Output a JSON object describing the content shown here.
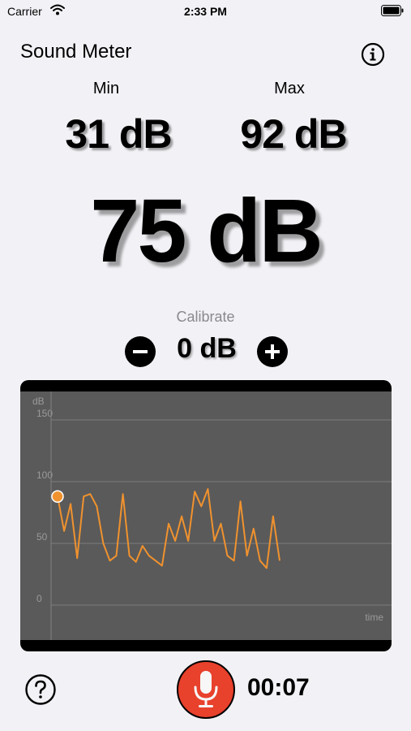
{
  "status": {
    "carrier": "Carrier",
    "time": "2:33 PM"
  },
  "app": {
    "title": "Sound Meter"
  },
  "stats": {
    "min_label": "Min",
    "min_value": "31 dB",
    "max_label": "Max",
    "max_value": "92 dB",
    "current_value": "75 dB"
  },
  "calibrate": {
    "label": "Calibrate",
    "value": "0 dB"
  },
  "recording": {
    "elapsed": "00:07",
    "accent_color": "#e8412c"
  },
  "chart_data": {
    "type": "line",
    "ylabel": "dB",
    "xlabel": "time",
    "ylim": [
      0,
      150
    ],
    "yticks": [
      0,
      50,
      100,
      150
    ],
    "grid": true,
    "line_color": "#f0922e",
    "background": "#5a5a5a",
    "series": [
      {
        "values": [
          88,
          60,
          82,
          38,
          88,
          90,
          80,
          50,
          36,
          40,
          90,
          40,
          35,
          48,
          40,
          36,
          32,
          66,
          52,
          72,
          52,
          92,
          80,
          94,
          52,
          66,
          40,
          36,
          84,
          40,
          62,
          36,
          30,
          72,
          36
        ]
      }
    ]
  }
}
